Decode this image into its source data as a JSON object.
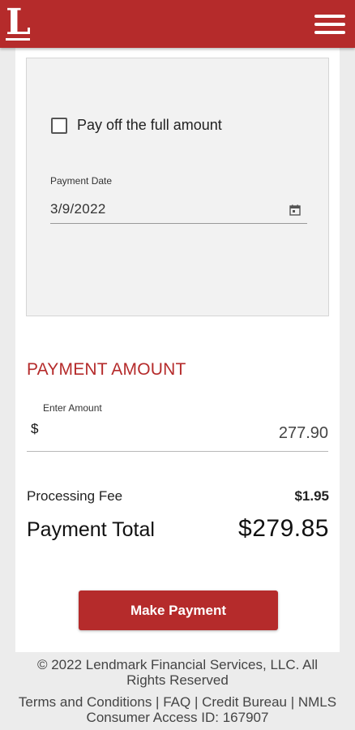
{
  "header": {
    "logo_text": "L",
    "brand_color": "#b52b2b"
  },
  "payment_form": {
    "pay_full_label": "Pay off the full amount",
    "pay_full_checked": false,
    "date_label": "Payment Date",
    "date_value": "3/9/2022"
  },
  "payment_amount": {
    "title": "PAYMENT AMOUNT",
    "enter_label": "Enter Amount",
    "currency_symbol": "$",
    "amount_value": "277.90"
  },
  "summary": {
    "fee_label": "Processing Fee",
    "fee_value": "$1.95",
    "total_label": "Payment Total",
    "total_value": "$279.85"
  },
  "actions": {
    "make_payment_label": "Make Payment"
  },
  "footer": {
    "copyright": "© 2022  Lendmark Financial Services, LLC. All Rights Reserved",
    "links": [
      "Terms and Conditions",
      "FAQ",
      "Credit Bureau"
    ],
    "separator": " | ",
    "nmls": "NMLS Consumer Access ID: 167907"
  }
}
